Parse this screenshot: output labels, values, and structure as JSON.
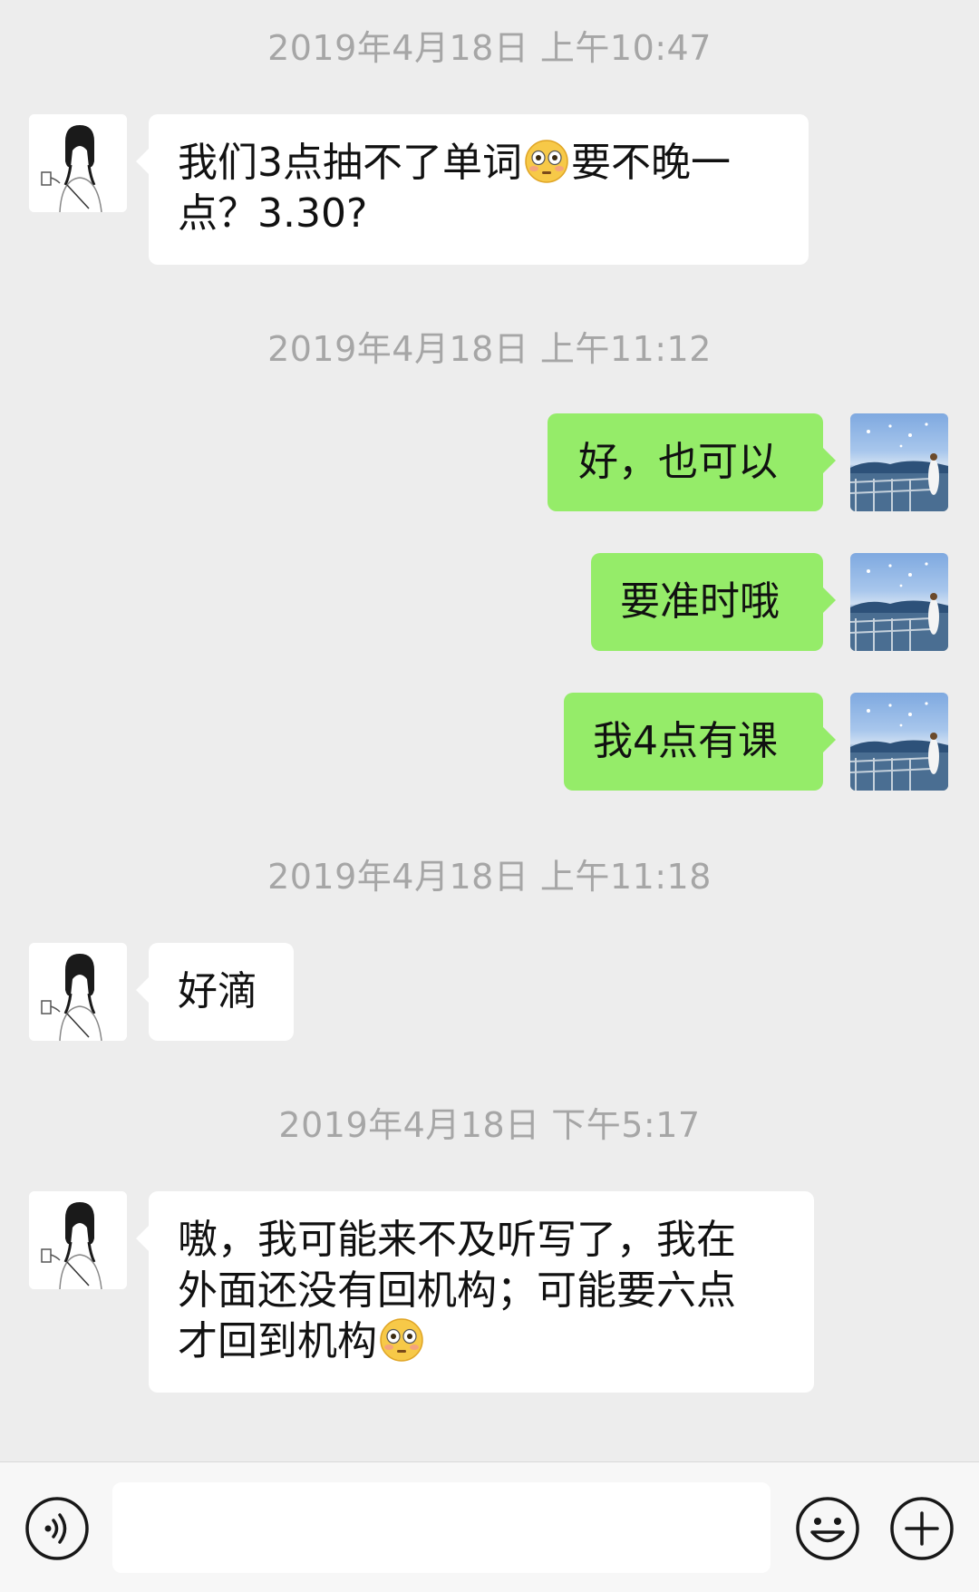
{
  "conversation": {
    "timestamps": [
      "2019年4月18日 上午10:47",
      "2019年4月18日 上午11:12",
      "2019年4月18日 上午11:18",
      "2019年4月18日 下午5:17"
    ],
    "messages": [
      {
        "from": "contact",
        "line1": "我们3点抽不了单词",
        "line1_after": "要不晚一",
        "line2": "点？3.30?"
      },
      {
        "from": "me",
        "text": "好，也可以"
      },
      {
        "from": "me",
        "text": "要准时哦"
      },
      {
        "from": "me",
        "text": "我4点有课"
      },
      {
        "from": "contact",
        "text": "好滴"
      },
      {
        "from": "contact",
        "line1": "嗷，我可能来不及听写了，我在",
        "line2": "外面还没有回机构；可能要六点",
        "line3": "才回到机构"
      }
    ]
  },
  "input_bar": {
    "value": "",
    "icons": [
      "voice-icon",
      "emoji-icon",
      "plus-icon"
    ]
  },
  "colors": {
    "background": "#ededed",
    "outgoing_bubble": "#95ec69",
    "incoming_bubble": "#ffffff",
    "timestamp_text": "#a6a6a6"
  }
}
